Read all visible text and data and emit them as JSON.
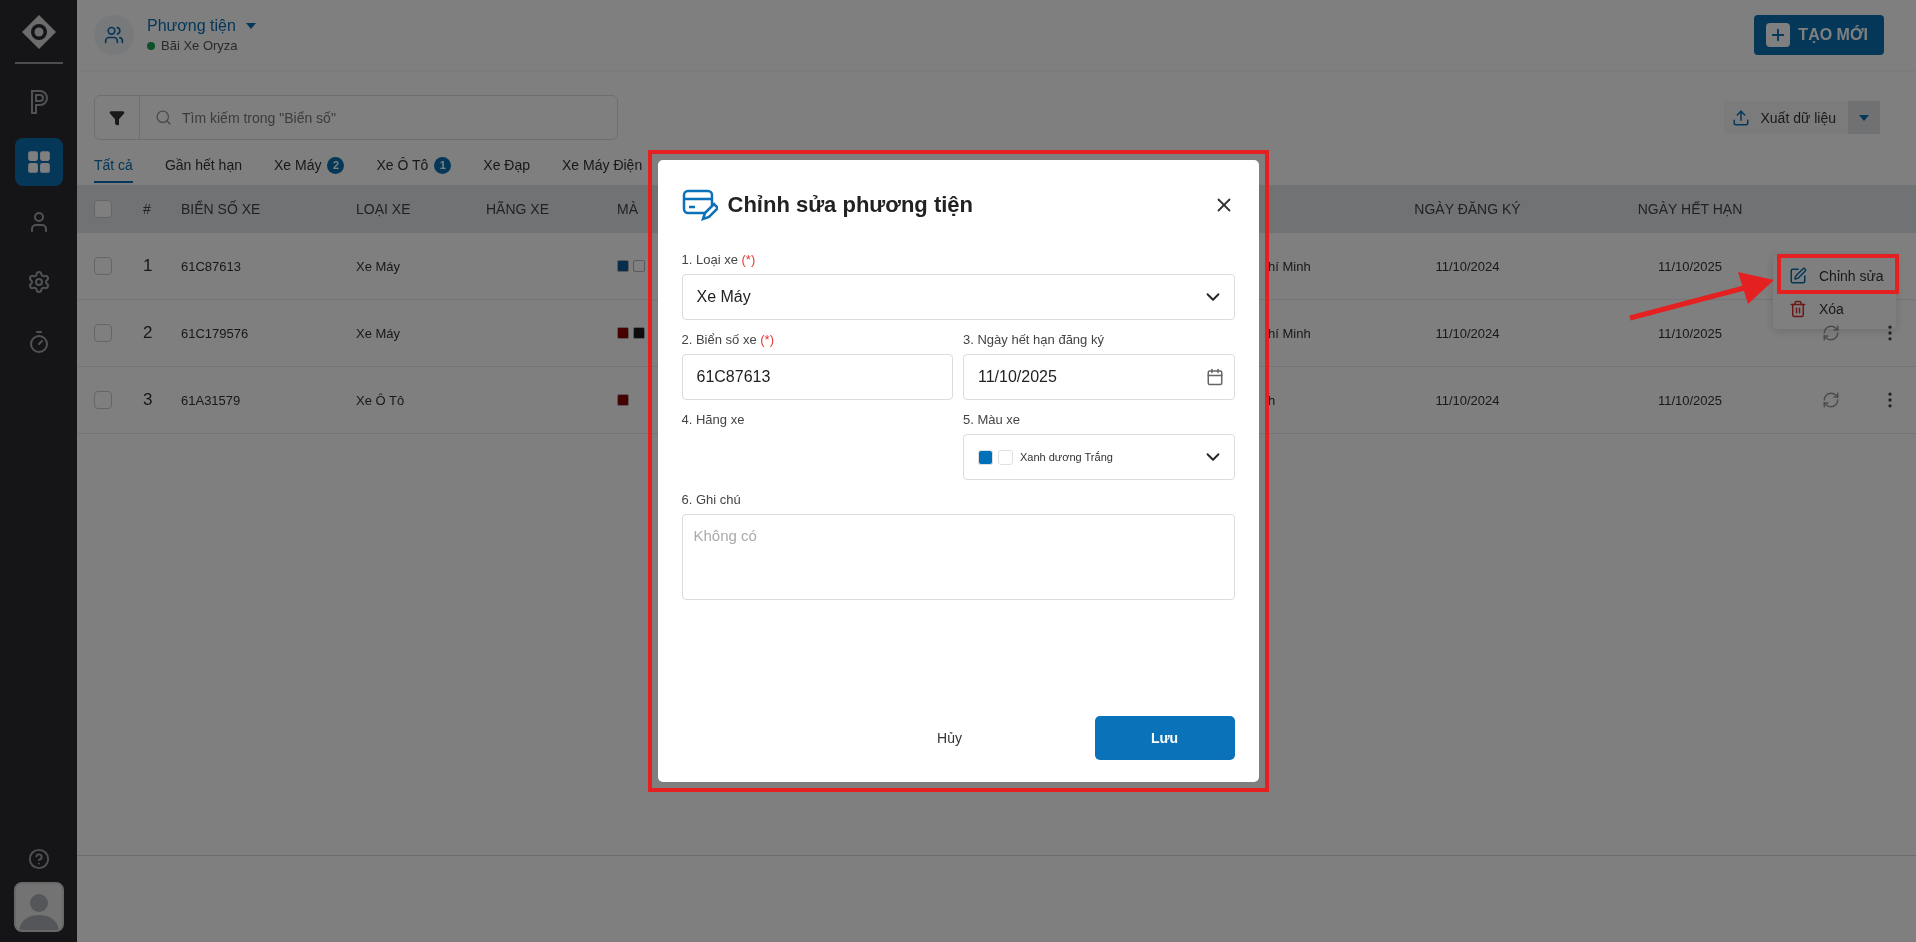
{
  "sidebar": {
    "items": [
      {
        "selected": false
      },
      {
        "selected": true
      },
      {
        "selected": false
      },
      {
        "selected": false
      },
      {
        "selected": false
      }
    ]
  },
  "header": {
    "title": "Phương tiện",
    "subtitle": "Bãi Xe Oryza",
    "create_button": "TẠO MỚI"
  },
  "toolbar": {
    "search_placeholder": "Tìm kiếm trong \"Biển số\"",
    "export_button": "Xuất dữ liệu"
  },
  "tabs": [
    {
      "label": "Tất cả",
      "selected": true
    },
    {
      "label": "Gần hết hạn",
      "selected": false
    },
    {
      "label": "Xe Máy",
      "count": "2",
      "selected": false
    },
    {
      "label": "Xe Ô Tô",
      "count": "1",
      "selected": false
    },
    {
      "label": "Xe Đạp",
      "selected": false
    },
    {
      "label": "Xe Máy Điện",
      "selected": false
    }
  ],
  "table": {
    "select_all_checked": false,
    "columns": [
      "#",
      "BIỂN SỐ XE",
      "LOẠI XE",
      "HÃNG XE",
      "MÀ",
      "NGÀY ĐĂNG KÝ",
      "NGÀY HẾT HẠN"
    ],
    "rows": [
      {
        "checked": false,
        "index": "1",
        "plate": "61C87613",
        "type": "Xe Máy",
        "colors": [
          {
            "color": "#062e4a"
          },
          {
            "color": "#808080"
          }
        ],
        "column_6": "hí Minh",
        "registered": "11/10/2024",
        "expires": "11/10/2025",
        "menu_open": true
      },
      {
        "checked": false,
        "index": "2",
        "plate": "61C179576",
        "type": "Xe Máy",
        "colors": [
          {
            "color": "#460000"
          },
          {
            "color": "#0d0d0d"
          }
        ],
        "column_6": "hí Minh",
        "registered": "11/10/2024",
        "expires": "11/10/2025",
        "menu_open": false
      },
      {
        "checked": false,
        "index": "3",
        "plate": "61A31579",
        "type": "Xe Ô Tô",
        "colors": [
          {
            "color": "#460000"
          }
        ],
        "column_6": "h",
        "registered": "11/10/2024",
        "expires": "11/10/2025",
        "menu_open": false
      }
    ]
  },
  "context_menu": {
    "items": [
      {
        "kind": "edit",
        "label": "Chỉnh sửa"
      },
      {
        "kind": "delete",
        "label": "Xóa"
      }
    ]
  },
  "modal": {
    "title": "Chỉnh sửa phương tiện",
    "fields": [
      {
        "kind": "select",
        "label": "1. Loại xe",
        "required_mark": "(*)",
        "value": "Xe Máy"
      },
      {
        "kind": "text",
        "label": "2. Biển số xe",
        "required_mark": "(*)",
        "value": "61C87613"
      },
      {
        "kind": "date",
        "label": "3. Ngày hết hạn đăng ký",
        "value": "11/10/2025"
      },
      {
        "kind": "empty",
        "label": "4. Hãng xe"
      },
      {
        "kind": "colors",
        "label": "5. Màu xe",
        "colors": [
          {
            "name": "Xanh dương",
            "color": "#0070b8"
          },
          {
            "name": "Trắng",
            "color": "#ffffff"
          }
        ]
      },
      {
        "kind": "textarea",
        "label": "6. Ghi chú",
        "placeholder": "Không có"
      }
    ],
    "cancel_button": "Hủy",
    "save_button": "Lưu"
  }
}
